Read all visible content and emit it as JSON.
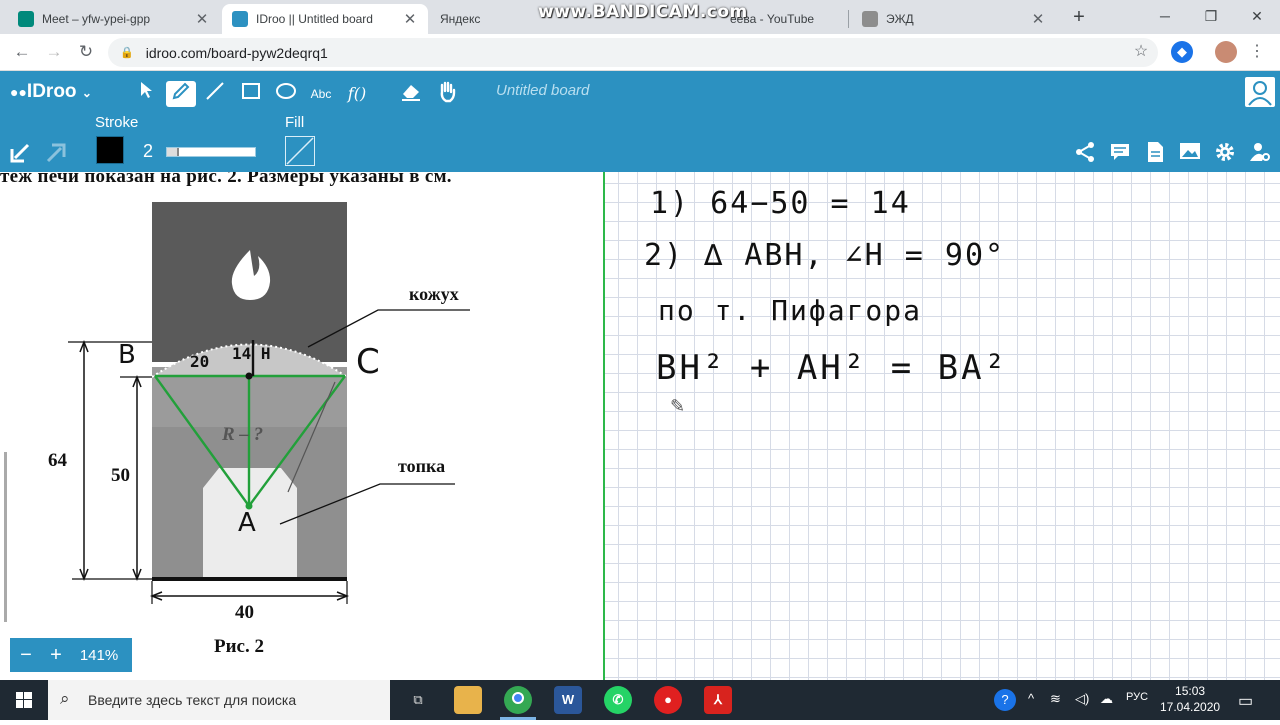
{
  "browser": {
    "tabs": [
      {
        "title": "Meet – yfw-ypei-gpp",
        "active": false
      },
      {
        "title": "IDroo || Untitled board",
        "active": true
      },
      {
        "title": "Яндекс",
        "active": false
      },
      {
        "title": "еева - YouTube",
        "active": false
      },
      {
        "title": "ЭЖД",
        "active": false
      }
    ],
    "url": "idroo.com/board-pyw2deqrq1",
    "recorder_watermark": "www.BANDICAM.com"
  },
  "app": {
    "logo": "IDroo",
    "board_title": "Untitled board",
    "tools": [
      "select-icon",
      "pen-icon",
      "line-icon",
      "rectangle-icon",
      "ellipse-icon",
      "text-tool",
      "formula-tool",
      "eraser-icon",
      "hand-icon"
    ],
    "text_tool_label": "Abc",
    "formula_tool_label": "f()",
    "stroke_label": "Stroke",
    "fill_label": "Fill",
    "stroke_width": "2",
    "stroke_color": "#000000",
    "accent": "#2c91c1"
  },
  "board": {
    "problem_text": "теж печи показан на рис. 2. Размеры указаны в см.",
    "figure": {
      "label_kozhukh": "кожух",
      "label_topka": "топка",
      "label_r": "R – ?",
      "dim_64": "64",
      "dim_50": "50",
      "dim_40": "40",
      "caption": "Рис. 2",
      "hw_B": "B",
      "hw_C": "C",
      "hw_A": "A",
      "hw_20": "20",
      "hw_14H": "14 H"
    },
    "handwriting": {
      "line1": "1)  64−50 = 14",
      "line2": "2)  ∆ ABH,  ∠H = 90°",
      "line3": "по т. Пифагора",
      "line4": "BH² + AH² = BA²"
    },
    "zoom": "141%",
    "zoom_minus": "−",
    "zoom_plus": "+"
  },
  "taskbar": {
    "search_placeholder": "Введите здесь текст для поиска",
    "lang": "РУС",
    "time": "15:03",
    "date": "17.04.2020"
  }
}
